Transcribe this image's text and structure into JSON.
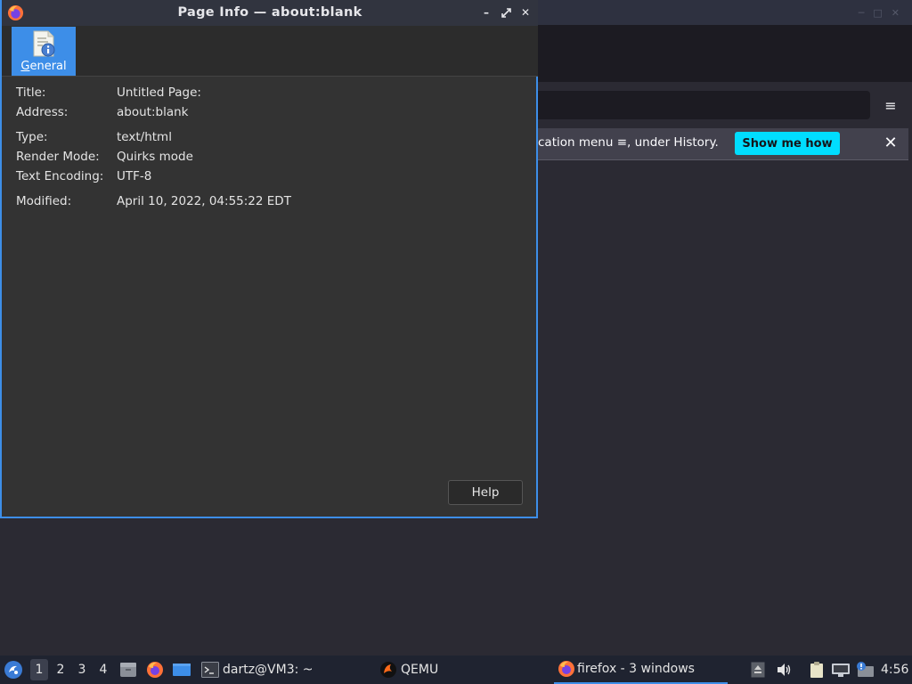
{
  "background_window": {
    "notice": {
      "text": "cation menu ≡, under History.",
      "button": "Show me how",
      "close_icon": "close-icon"
    },
    "menu_icon": "hamburger-menu-icon",
    "window_controls": [
      "minimize-icon",
      "maximize-icon",
      "close-icon"
    ]
  },
  "dialog": {
    "title": "Page Info — about:blank",
    "app_icon": "firefox-icon",
    "controls": [
      "minimize-icon",
      "maximize-icon",
      "close-icon"
    ],
    "tabs": [
      {
        "label": "General",
        "icon": "page-info-icon",
        "accel": "G",
        "selected": true
      }
    ],
    "fields": {
      "title": {
        "label": "Title:",
        "value": "Untitled Page:"
      },
      "address": {
        "label": "Address:",
        "value": "about:blank"
      },
      "type": {
        "label": "Type:",
        "value": "text/html"
      },
      "render_mode": {
        "label": "Render Mode:",
        "value": "Quirks mode"
      },
      "encoding": {
        "label": "Text Encoding:",
        "value": "UTF-8"
      },
      "modified": {
        "label": "Modified:",
        "value": "April 10, 2022, 04:55:22 EDT"
      }
    },
    "help_button": "Help"
  },
  "taskbar": {
    "workspaces": [
      "1",
      "2",
      "3",
      "4"
    ],
    "active_workspace": "1",
    "tasks": {
      "terminal": "dartz@VM3: ~",
      "qemu": "QEMU",
      "firefox": "firefox - 3 windows"
    },
    "clock": "4:56",
    "colors": {
      "accent": "#3d8ee8",
      "notice_button": "#00ddff"
    }
  }
}
